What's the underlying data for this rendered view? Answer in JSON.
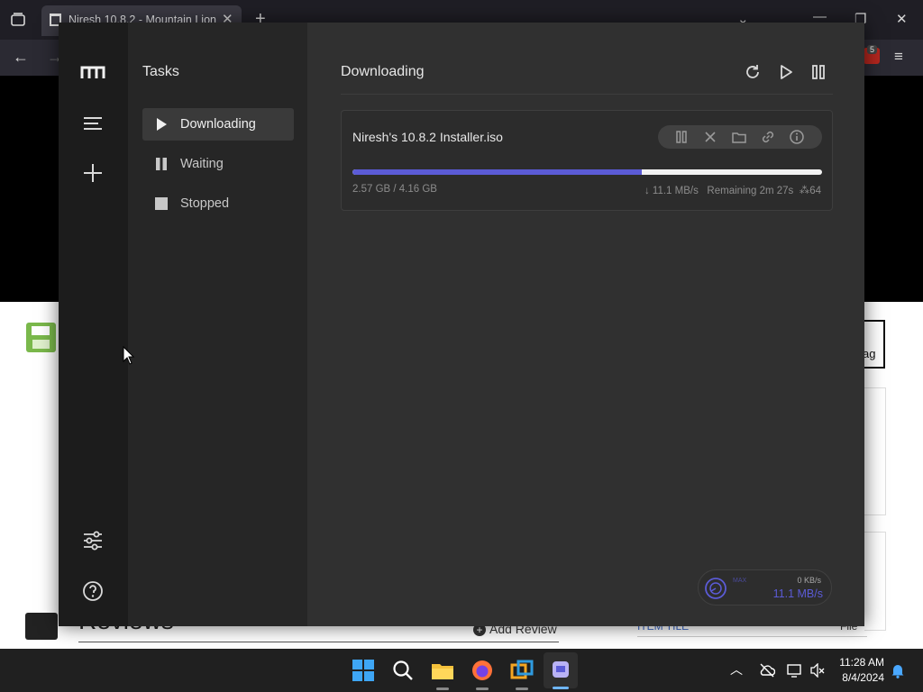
{
  "browser": {
    "tab_title": "Niresh 10.8.2 - Mountain Lion",
    "badge_count": "5",
    "behind_text_tag": "ag",
    "behind_reviews": "Reviews",
    "behind_add_review": "Add Review",
    "behind_item_title": "ITEM TILE",
    "behind_file": "File"
  },
  "app": {
    "window_controls": {
      "minimize": "—",
      "maximize": "▢",
      "close": "✕"
    },
    "rail": {
      "logo": "motrix-logo",
      "items": [
        {
          "name": "menu-icon"
        },
        {
          "name": "add-task-icon"
        },
        {
          "name": "preferences-icon"
        },
        {
          "name": "help-icon"
        }
      ]
    },
    "subnav": {
      "title": "Tasks",
      "items": [
        {
          "label": "Downloading",
          "icon": "play-icon",
          "active": true
        },
        {
          "label": "Waiting",
          "icon": "pause-icon",
          "active": false
        },
        {
          "label": "Stopped",
          "icon": "stop-icon",
          "active": false
        }
      ]
    },
    "main": {
      "title": "Downloading",
      "task": {
        "name": "Niresh's 10.8.2 Installer.iso",
        "progress_fraction": 0.617,
        "size_text": "2.57 GB / 4.16 GB",
        "speed_text": "↓ 11.1 MB/s",
        "remaining_text": "Remaining 2m 27s",
        "connections_text": "64"
      },
      "speedometer": {
        "label": "MAX",
        "upload": "0 KB/s",
        "download": "11.1 MB/s"
      }
    }
  },
  "taskbar": {
    "time": "11:28 AM",
    "date": "8/4/2024"
  },
  "colors": {
    "accent": "#5b5bd6",
    "rail_bg": "#1c1c1c",
    "subnav_bg": "#262626",
    "main_bg": "#303030"
  }
}
